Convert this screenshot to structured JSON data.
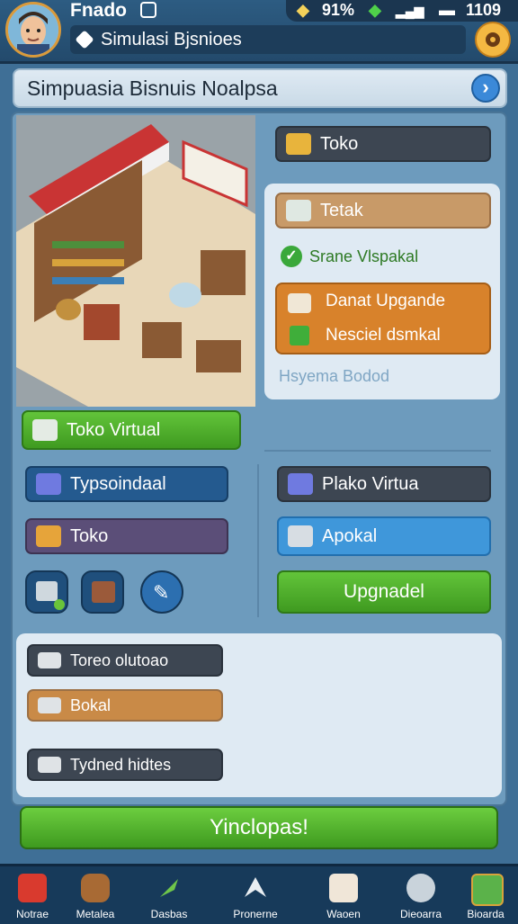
{
  "topbar": {
    "player_name": "Fnado",
    "subtitle": "Simulasi Bjsnioes",
    "status": {
      "percent": "91%",
      "time": "1109"
    }
  },
  "header": {
    "title": "Simpuasia Bisnuis Noalpsa"
  },
  "right_column": {
    "toko_label": "Toko",
    "card": {
      "tetak_label": "Tetak",
      "check_text": "Srane Vlspakal",
      "upgrade_line1": "Danat Upgande",
      "upgrade_line2": "Nesciel dsmkal",
      "footer_text": "Hsyema Bodod"
    },
    "plako_label": "Plako Virtua",
    "apoka_label": "Apokal",
    "upgrade_button": "Upgnadel"
  },
  "left_column": {
    "toko_virtual_button": "Toko Virtual",
    "typso_label": "Typsoindaal",
    "toko_label": "Toko"
  },
  "lower_panel": {
    "items": [
      "Toreo olutoao",
      "Bokal",
      "Tydned hidtes"
    ]
  },
  "cta_button": "Yinclopas!",
  "nav": {
    "items": [
      {
        "label": "Notrae",
        "icon": "red-cube-icon"
      },
      {
        "label": "Metalea",
        "icon": "barrel-icon"
      },
      {
        "label": "Dasbas",
        "icon": "rocket-icon"
      },
      {
        "label": "Pronerne",
        "icon": "arrow-icon"
      },
      {
        "label": "Waoen",
        "icon": "bag-icon"
      },
      {
        "label": "Dieoarra",
        "icon": "tool-icon"
      },
      {
        "label": "Bioarda",
        "icon": "clock-icon"
      }
    ]
  }
}
